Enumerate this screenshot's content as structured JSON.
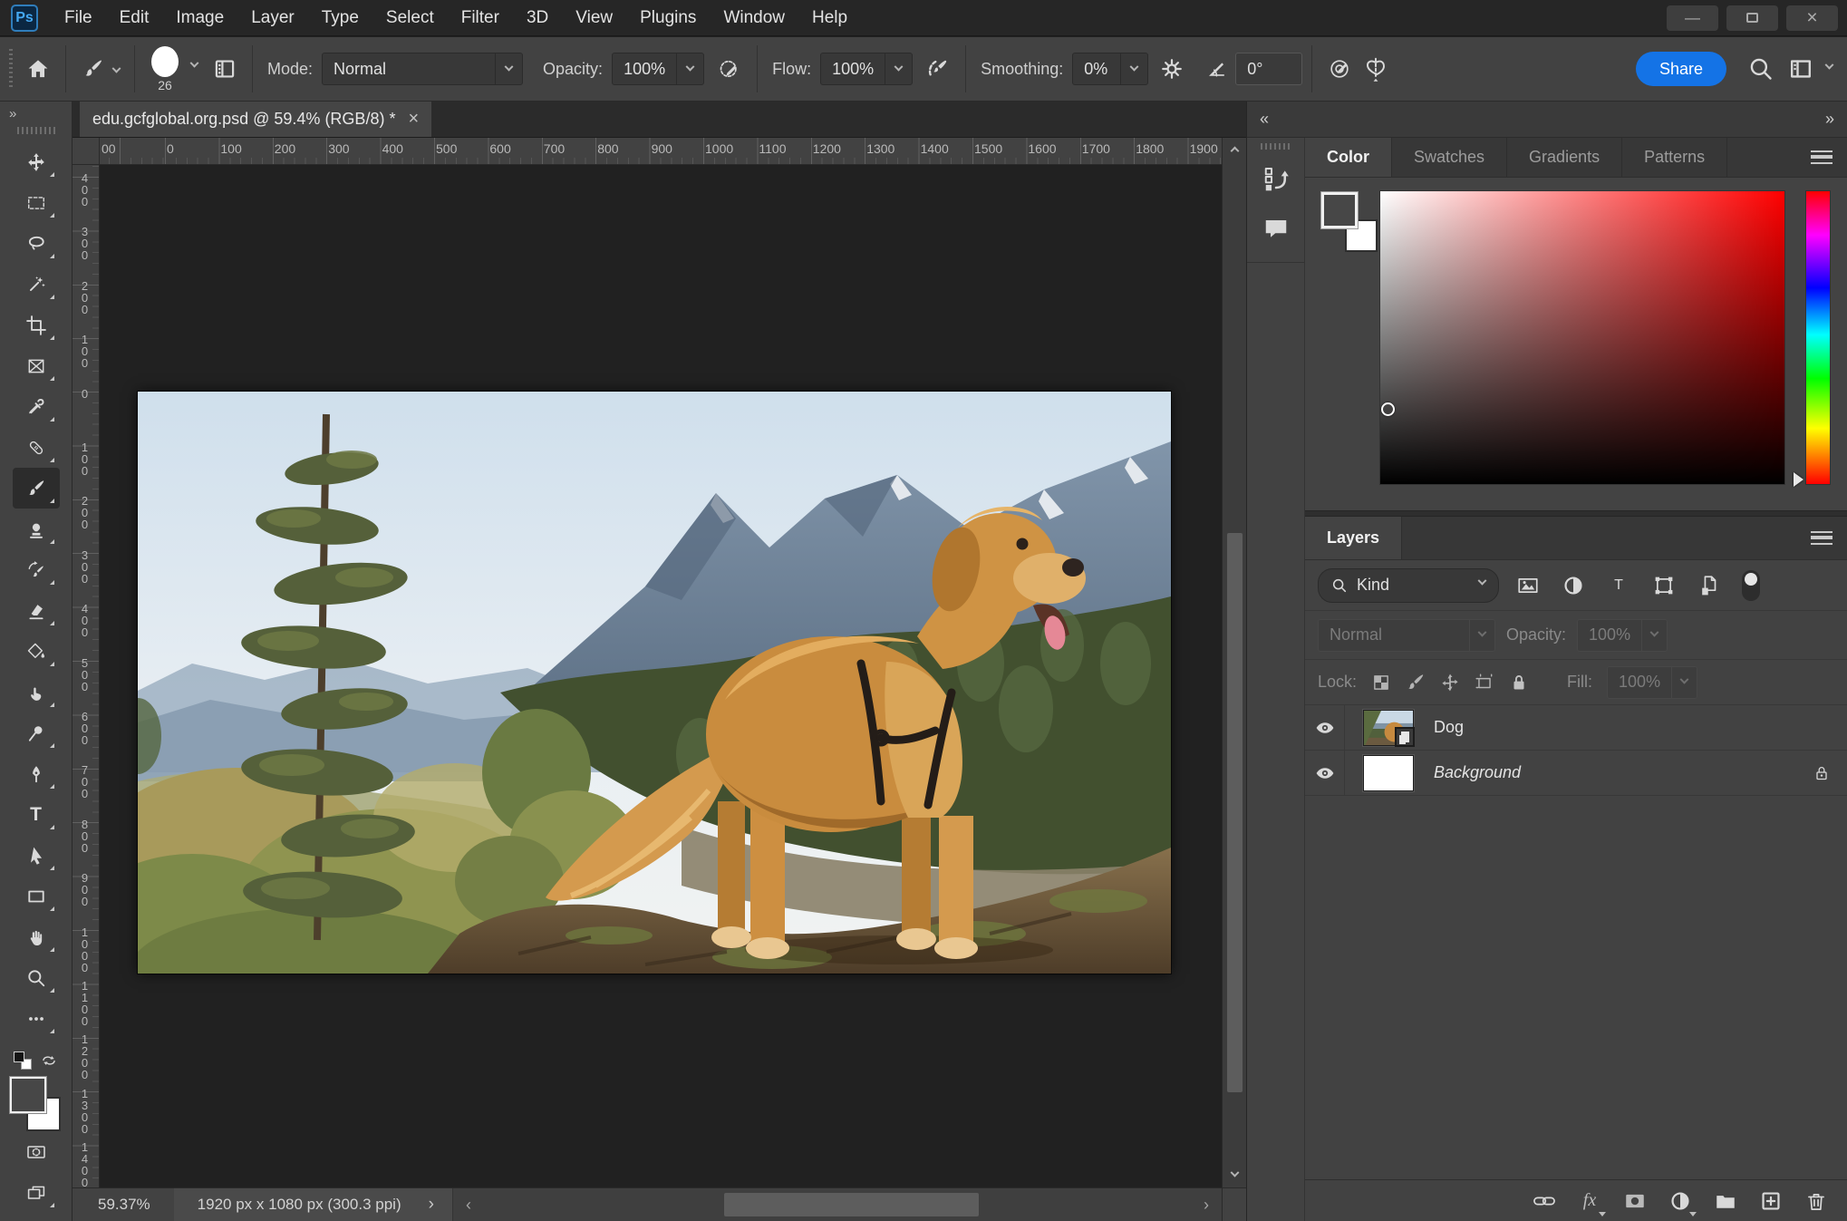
{
  "titlebar": {
    "logo_text": "Ps",
    "menus": [
      "File",
      "Edit",
      "Image",
      "Layer",
      "Type",
      "Select",
      "Filter",
      "3D",
      "View",
      "Plugins",
      "Window",
      "Help"
    ],
    "controls": {
      "minimize": "—",
      "close": "×"
    }
  },
  "optionsbar": {
    "brush_size": "26",
    "mode_label": "Mode:",
    "mode_value": "Normal",
    "opacity_label": "Opacity:",
    "opacity_value": "100%",
    "flow_label": "Flow:",
    "flow_value": "100%",
    "smoothing_label": "Smoothing:",
    "smoothing_value": "0%",
    "angle_value": "0°",
    "share_label": "Share"
  },
  "tabbar": {
    "doc_title": "edu.gcfglobal.org.psd @ 59.4% (RGB/8) *",
    "close_glyph": "×"
  },
  "toolbar": {
    "expand_glyph": "»",
    "type_tool_glyph": "T"
  },
  "rulers": {
    "h_labels": [
      "00",
      "0",
      "100",
      "200",
      "300",
      "400",
      "500",
      "600",
      "700",
      "800",
      "900",
      "1000",
      "1100",
      "1200",
      "1300",
      "1400",
      "1500",
      "1600",
      "1700",
      "1800",
      "1900"
    ],
    "v_labels": [
      "400",
      "300",
      "200",
      "100",
      "0",
      "100",
      "200",
      "300",
      "400",
      "500",
      "600",
      "700",
      "800",
      "900",
      "1000",
      "1100",
      "1200",
      "1300",
      "1400"
    ]
  },
  "canvas": {
    "photo_description": "Golden retriever wearing a black harness standing on a rocky ledge in front of forested mountains"
  },
  "statusbar": {
    "zoom_level": "59.37%",
    "doc_info": "1920 px x 1080 px (300.3 ppi)",
    "expand_glyph": "›",
    "scroll_left": "‹",
    "scroll_right": "›"
  },
  "dock": {
    "collapse_left": "«",
    "collapse_right": "»"
  },
  "color_panel": {
    "tabs": {
      "0": "Color",
      "1": "Swatches",
      "2": "Gradients",
      "3": "Patterns"
    },
    "active_tab": "Color",
    "foreground_color": "#474747",
    "background_color": "#ffffff",
    "hue_selected": "#ff0000"
  },
  "layers_panel": {
    "title": "Layers",
    "kind_label": "Kind",
    "filter_type_glyph": "T",
    "blend_mode": "Normal",
    "opacity_label": "Opacity:",
    "opacity_value": "100%",
    "lock_label": "Lock:",
    "fill_label": "Fill:",
    "fill_value": "100%",
    "layers": {
      "0": {
        "name": "Dog"
      },
      "1": {
        "name": "Background"
      }
    },
    "fx_glyph": "fx"
  },
  "colors": {
    "accent_blue": "#1473e6",
    "panel_bg": "#424242",
    "pasteboard_bg": "#212121",
    "titlebar_bg": "#262626"
  }
}
